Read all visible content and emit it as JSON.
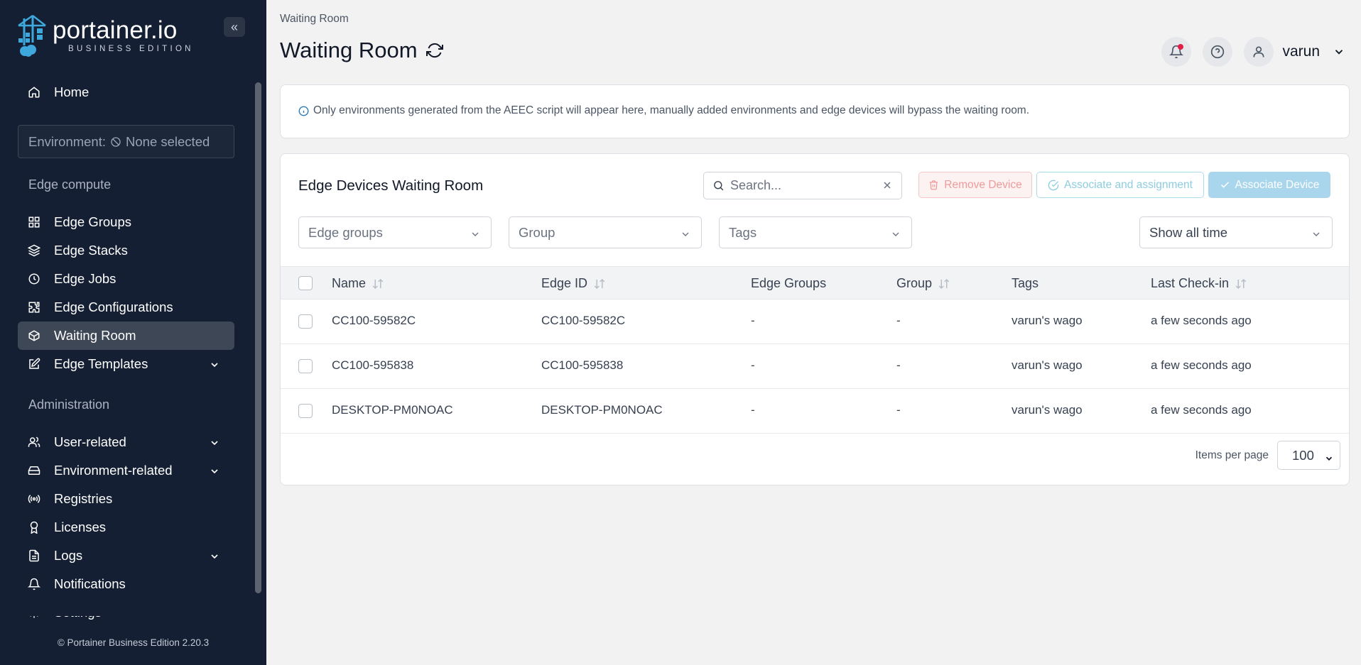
{
  "brand": {
    "title": "portainer.io",
    "subtitle": "BUSINESS EDITION"
  },
  "sidebar": {
    "home": "Home",
    "environment_label": "Environment:",
    "environment_value": "None selected",
    "section_edge": "Edge compute",
    "edge_items": [
      {
        "label": "Edge Groups",
        "icon": "grid-icon"
      },
      {
        "label": "Edge Stacks",
        "icon": "layers-icon"
      },
      {
        "label": "Edge Jobs",
        "icon": "clock-icon"
      },
      {
        "label": "Edge Configurations",
        "icon": "puzzle-icon"
      },
      {
        "label": "Waiting Room",
        "icon": "box-icon",
        "active": true
      },
      {
        "label": "Edge Templates",
        "icon": "edit-icon",
        "expandable": true
      }
    ],
    "section_admin": "Administration",
    "admin_items": [
      {
        "label": "User-related",
        "icon": "users-icon",
        "expandable": true
      },
      {
        "label": "Environment-related",
        "icon": "hard-drive-icon",
        "expandable": true
      },
      {
        "label": "Registries",
        "icon": "radio-icon"
      },
      {
        "label": "Licenses",
        "icon": "award-icon"
      },
      {
        "label": "Logs",
        "icon": "file-text-icon",
        "expandable": true
      },
      {
        "label": "Notifications",
        "icon": "bell-icon"
      },
      {
        "label": "Settings",
        "icon": "settings-icon",
        "expandable": true
      }
    ],
    "footer": "© Portainer Business Edition  2.20.3"
  },
  "header": {
    "breadcrumb": "Waiting Room",
    "title": "Waiting Room",
    "user": "varun"
  },
  "info": {
    "text": "Only environments generated from the AEEC script will appear here, manually added environments and edge devices will bypass the waiting room."
  },
  "table": {
    "title": "Edge Devices Waiting Room",
    "search_placeholder": "Search...",
    "buttons": {
      "remove": "Remove Device",
      "assign": "Associate and assignment",
      "associate": "Associate Device"
    },
    "filters": {
      "edge_groups": "Edge groups",
      "group": "Group",
      "tags": "Tags",
      "time": "Show all time"
    },
    "columns": [
      "Name",
      "Edge ID",
      "Edge Groups",
      "Group",
      "Tags",
      "Last Check-in"
    ],
    "rows": [
      {
        "name": "CC100-59582C",
        "edge_id": "CC100-59582C",
        "edge_groups": "-",
        "group": "-",
        "tags": "varun's wago",
        "checkin": "a few seconds ago"
      },
      {
        "name": "CC100-595838",
        "edge_id": "CC100-595838",
        "edge_groups": "-",
        "group": "-",
        "tags": "varun's wago",
        "checkin": "a few seconds ago"
      },
      {
        "name": "DESKTOP-PM0NOAC",
        "edge_id": "DESKTOP-PM0NOAC",
        "edge_groups": "-",
        "group": "-",
        "tags": "varun's wago",
        "checkin": "a few seconds ago"
      }
    ],
    "items_per_page_label": "Items per page",
    "items_per_page": "100"
  },
  "colors": {
    "sidebar_bg": "#141f33",
    "accent": "#3ea8dc",
    "danger": "#e11d48"
  }
}
